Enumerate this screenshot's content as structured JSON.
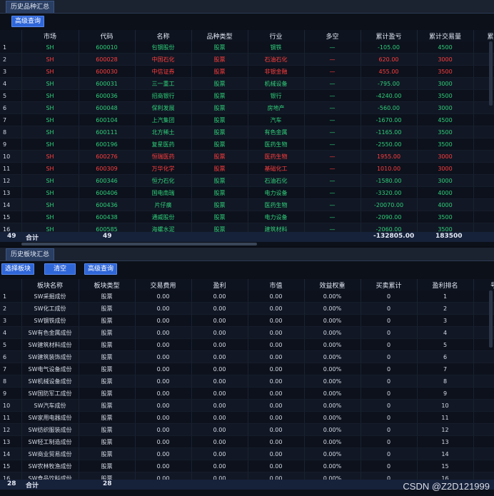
{
  "top": {
    "tab": "历史品种汇总",
    "advanced_query": "高级查询",
    "columns": [
      "",
      "市场",
      "代码",
      "名称",
      "品种类型",
      "行业",
      "多空",
      "累计盈亏",
      "累计交易量",
      "累计"
    ],
    "rows": [
      {
        "i": "1",
        "market": "SH",
        "code": "600010",
        "name": "包钢股份",
        "type": "股票",
        "industry": "钢铁",
        "ls": "—",
        "pnl": "-105.00",
        "vol": "4500",
        "dir": "down"
      },
      {
        "i": "2",
        "market": "SH",
        "code": "600028",
        "name": "中国石化",
        "type": "股票",
        "industry": "石油石化",
        "ls": "—",
        "pnl": "620.00",
        "vol": "3000",
        "dir": "up"
      },
      {
        "i": "3",
        "market": "SH",
        "code": "600030",
        "name": "中信证券",
        "type": "股票",
        "industry": "非银金融",
        "ls": "—",
        "pnl": "455.00",
        "vol": "3500",
        "dir": "up"
      },
      {
        "i": "4",
        "market": "SH",
        "code": "600031",
        "name": "三一重工",
        "type": "股票",
        "industry": "机械设备",
        "ls": "—",
        "pnl": "-795.00",
        "vol": "3000",
        "dir": "down"
      },
      {
        "i": "5",
        "market": "SH",
        "code": "600036",
        "name": "招商银行",
        "type": "股票",
        "industry": "银行",
        "ls": "—",
        "pnl": "-4240.00",
        "vol": "3500",
        "dir": "down"
      },
      {
        "i": "6",
        "market": "SH",
        "code": "600048",
        "name": "保利发展",
        "type": "股票",
        "industry": "房地产",
        "ls": "—",
        "pnl": "-560.00",
        "vol": "3000",
        "dir": "down"
      },
      {
        "i": "7",
        "market": "SH",
        "code": "600104",
        "name": "上汽集团",
        "type": "股票",
        "industry": "汽车",
        "ls": "—",
        "pnl": "-1670.00",
        "vol": "4500",
        "dir": "down"
      },
      {
        "i": "8",
        "market": "SH",
        "code": "600111",
        "name": "北方稀土",
        "type": "股票",
        "industry": "有色金属",
        "ls": "—",
        "pnl": "-1165.00",
        "vol": "3500",
        "dir": "down"
      },
      {
        "i": "9",
        "market": "SH",
        "code": "600196",
        "name": "复星医药",
        "type": "股票",
        "industry": "医药生物",
        "ls": "—",
        "pnl": "-2550.00",
        "vol": "3500",
        "dir": "down"
      },
      {
        "i": "10",
        "market": "SH",
        "code": "600276",
        "name": "恒瑞医药",
        "type": "股票",
        "industry": "医药生物",
        "ls": "—",
        "pnl": "1955.00",
        "vol": "3000",
        "dir": "up"
      },
      {
        "i": "11",
        "market": "SH",
        "code": "600309",
        "name": "万华化学",
        "type": "股票",
        "industry": "基础化工",
        "ls": "—",
        "pnl": "1010.00",
        "vol": "3000",
        "dir": "up"
      },
      {
        "i": "12",
        "market": "SH",
        "code": "600346",
        "name": "恒力石化",
        "type": "股票",
        "industry": "石油石化",
        "ls": "—",
        "pnl": "-1580.00",
        "vol": "3000",
        "dir": "down"
      },
      {
        "i": "13",
        "market": "SH",
        "code": "600406",
        "name": "国电南瑞",
        "type": "股票",
        "industry": "电力设备",
        "ls": "—",
        "pnl": "-3320.00",
        "vol": "4000",
        "dir": "down"
      },
      {
        "i": "14",
        "market": "SH",
        "code": "600436",
        "name": "片仔癀",
        "type": "股票",
        "industry": "医药生物",
        "ls": "—",
        "pnl": "-20070.00",
        "vol": "4000",
        "dir": "down"
      },
      {
        "i": "15",
        "market": "SH",
        "code": "600438",
        "name": "通威股份",
        "type": "股票",
        "industry": "电力设备",
        "ls": "—",
        "pnl": "-2090.00",
        "vol": "3500",
        "dir": "down"
      },
      {
        "i": "16",
        "market": "SH",
        "code": "600585",
        "name": "海螺水泥",
        "type": "股票",
        "industry": "建筑材料",
        "ls": "—",
        "pnl": "-2060.00",
        "vol": "3500",
        "dir": "down"
      }
    ],
    "footer": {
      "count": "49",
      "label": "合计",
      "code_count": "49",
      "pnl": "-132805.00",
      "vol": "183500"
    }
  },
  "bottom": {
    "tab": "历史板块汇总",
    "select_btn": "选择板块",
    "clear_btn": "清空",
    "advanced_query": "高级查询",
    "columns": [
      "",
      "板块名称",
      "板块类型",
      "交易费用",
      "盈利",
      "市值",
      "效益权重",
      "买卖累计",
      "盈利排名",
      "号"
    ],
    "rows": [
      {
        "i": "1",
        "name": "SW采掘成份",
        "type": "股票",
        "fee": "0.00",
        "profit": "0.00",
        "mv": "0.00",
        "w": "0.00%",
        "cum": "0",
        "rank": "1"
      },
      {
        "i": "2",
        "name": "SW化工成份",
        "type": "股票",
        "fee": "0.00",
        "profit": "0.00",
        "mv": "0.00",
        "w": "0.00%",
        "cum": "0",
        "rank": "2"
      },
      {
        "i": "3",
        "name": "SW钢铁成份",
        "type": "股票",
        "fee": "0.00",
        "profit": "0.00",
        "mv": "0.00",
        "w": "0.00%",
        "cum": "0",
        "rank": "3"
      },
      {
        "i": "4",
        "name": "SW有色金属成份",
        "type": "股票",
        "fee": "0.00",
        "profit": "0.00",
        "mv": "0.00",
        "w": "0.00%",
        "cum": "0",
        "rank": "4"
      },
      {
        "i": "5",
        "name": "SW建筑材料成份",
        "type": "股票",
        "fee": "0.00",
        "profit": "0.00",
        "mv": "0.00",
        "w": "0.00%",
        "cum": "0",
        "rank": "5"
      },
      {
        "i": "6",
        "name": "SW建筑装饰成份",
        "type": "股票",
        "fee": "0.00",
        "profit": "0.00",
        "mv": "0.00",
        "w": "0.00%",
        "cum": "0",
        "rank": "6"
      },
      {
        "i": "7",
        "name": "SW电气设备成份",
        "type": "股票",
        "fee": "0.00",
        "profit": "0.00",
        "mv": "0.00",
        "w": "0.00%",
        "cum": "0",
        "rank": "7"
      },
      {
        "i": "8",
        "name": "SW机械设备成份",
        "type": "股票",
        "fee": "0.00",
        "profit": "0.00",
        "mv": "0.00",
        "w": "0.00%",
        "cum": "0",
        "rank": "8"
      },
      {
        "i": "9",
        "name": "SW国防军工成份",
        "type": "股票",
        "fee": "0.00",
        "profit": "0.00",
        "mv": "0.00",
        "w": "0.00%",
        "cum": "0",
        "rank": "9"
      },
      {
        "i": "10",
        "name": "SW汽车成份",
        "type": "股票",
        "fee": "0.00",
        "profit": "0.00",
        "mv": "0.00",
        "w": "0.00%",
        "cum": "0",
        "rank": "10"
      },
      {
        "i": "11",
        "name": "SW家用电器成份",
        "type": "股票",
        "fee": "0.00",
        "profit": "0.00",
        "mv": "0.00",
        "w": "0.00%",
        "cum": "0",
        "rank": "11"
      },
      {
        "i": "12",
        "name": "SW纺织服装成份",
        "type": "股票",
        "fee": "0.00",
        "profit": "0.00",
        "mv": "0.00",
        "w": "0.00%",
        "cum": "0",
        "rank": "12"
      },
      {
        "i": "13",
        "name": "SW轻工制造成份",
        "type": "股票",
        "fee": "0.00",
        "profit": "0.00",
        "mv": "0.00",
        "w": "0.00%",
        "cum": "0",
        "rank": "13"
      },
      {
        "i": "14",
        "name": "SW商业贸易成份",
        "type": "股票",
        "fee": "0.00",
        "profit": "0.00",
        "mv": "0.00",
        "w": "0.00%",
        "cum": "0",
        "rank": "14"
      },
      {
        "i": "15",
        "name": "SW农林牧渔成份",
        "type": "股票",
        "fee": "0.00",
        "profit": "0.00",
        "mv": "0.00",
        "w": "0.00%",
        "cum": "0",
        "rank": "15"
      },
      {
        "i": "16",
        "name": "SW食品饮料成份",
        "type": "股票",
        "fee": "0.00",
        "profit": "0.00",
        "mv": "0.00",
        "w": "0.00%",
        "cum": "0",
        "rank": "16"
      }
    ],
    "footer": {
      "count": "28",
      "label": "合计",
      "name_count": "28"
    }
  },
  "watermark": "CSDN @Z2D121999"
}
